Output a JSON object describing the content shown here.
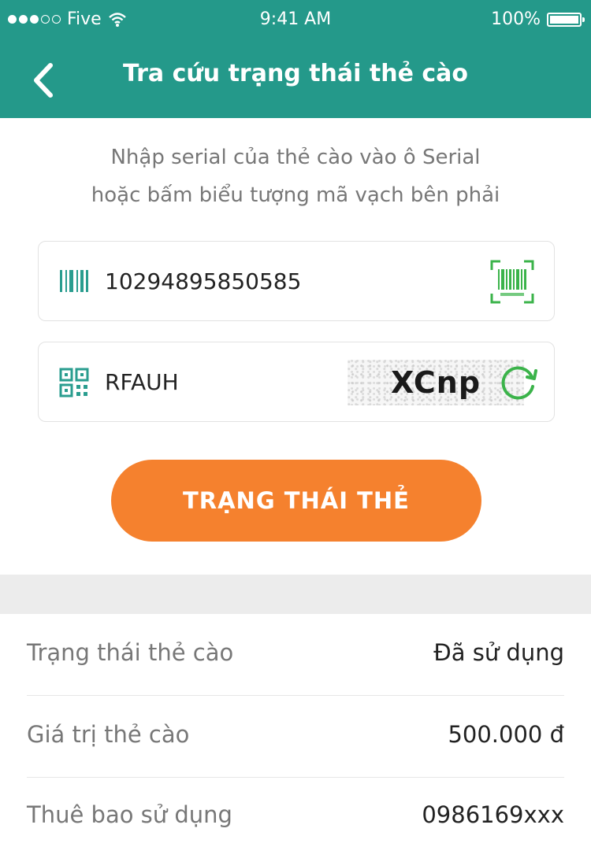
{
  "status_bar": {
    "carrier": "Five",
    "time": "9:41 AM",
    "battery": "100%"
  },
  "nav": {
    "title": "Tra cứu trạng thái thẻ cào",
    "back_icon": "chevron-left-icon"
  },
  "instruction": {
    "line1": "Nhập serial của thẻ cào vào ô Serial",
    "line2": "hoặc bấm biểu tượng mã vạch bên phải"
  },
  "serial_field": {
    "value": "10294895850585",
    "leading_icon": "barcode-icon",
    "action_icon": "barcode-scan-icon"
  },
  "captcha_field": {
    "value": "RFAUH",
    "leading_icon": "qr-code-icon",
    "captcha_text": "XCnp",
    "action_icon": "refresh-icon"
  },
  "submit_button": {
    "label": "TRẠNG THÁI THẺ"
  },
  "results": [
    {
      "label": "Trạng thái thẻ cào",
      "value": "Đã sử dụng"
    },
    {
      "label": "Giá trị thẻ cào",
      "value": "500.000 đ"
    },
    {
      "label": "Thuê bao sử dụng",
      "value": "0986169xxx"
    }
  ],
  "colors": {
    "header": "#24998a",
    "accent_orange": "#f5812e",
    "icon_teal": "#2a9d8f",
    "icon_green": "#3bb34a"
  }
}
